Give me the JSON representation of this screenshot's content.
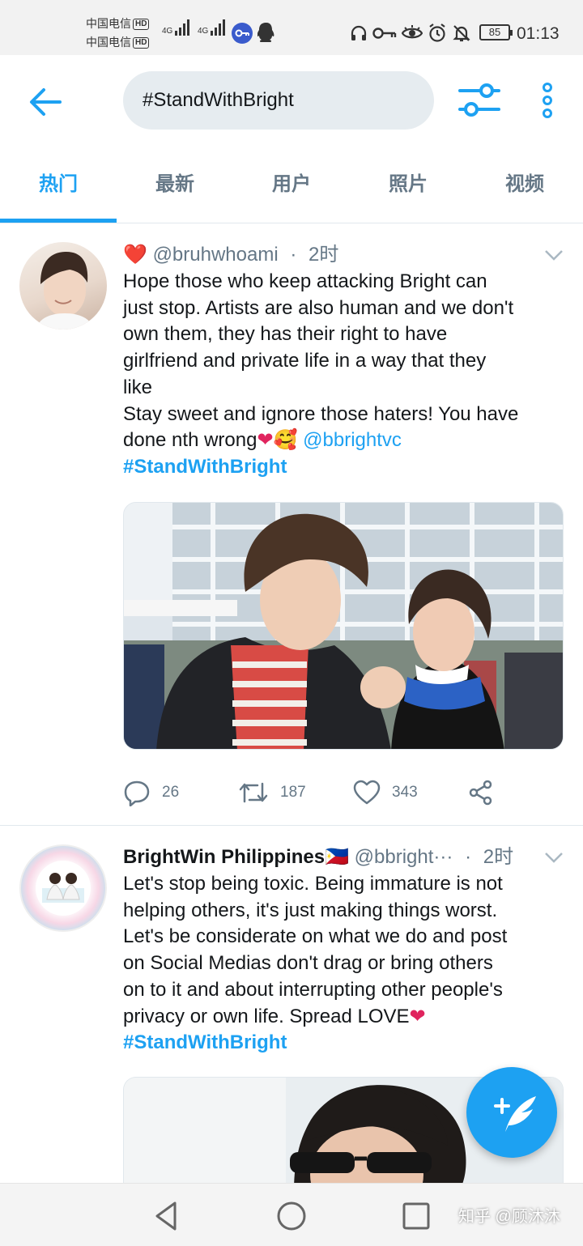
{
  "status_bar": {
    "carrier_1": "中国电信",
    "carrier_2": "中国电信",
    "hd_label": "HD",
    "network_1": "4G",
    "network_2": "4G",
    "battery": "85",
    "time": "01:13",
    "icons": [
      "vpn-key-icon",
      "qq-icon",
      "headphones-icon",
      "key-icon",
      "eye-icon",
      "alarm-icon",
      "mute-icon"
    ]
  },
  "header": {
    "search_text": "#StandWithBright",
    "back_icon": "arrow-left-icon",
    "filter_icon": "sliders-icon",
    "more_icon": "more-vertical-icon"
  },
  "tabs": [
    {
      "label": "热门",
      "active": true
    },
    {
      "label": "最新",
      "active": false
    },
    {
      "label": "用户",
      "active": false
    },
    {
      "label": "照片",
      "active": false
    },
    {
      "label": "视频",
      "active": false
    }
  ],
  "tweets": [
    {
      "name": "❤️",
      "handle": "@bruhwhoami",
      "dot": "·",
      "time": "2时",
      "lines": [
        "Hope those who keep attacking Bright can",
        "just stop. Artists are also human and we don't",
        "own them, they has their right to have",
        "girlfriend and private life in a way that they",
        "like",
        "Stay sweet and ignore those haters! You have"
      ],
      "last_line_text": "done nth wrong",
      "last_line_emoji": "❤🥰",
      "mention": "@bbrightvc",
      "hashtag": "#StandWithBright",
      "replies": "26",
      "retweets": "187",
      "likes": "343"
    },
    {
      "name": "BrightWin Philippines🇵🇭",
      "handle": "@bbright···",
      "dot": "·",
      "time": "2时",
      "lines": [
        "Let's stop being toxic. Being immature is not",
        "helping others, it's just making things worst.",
        "Let's be considerate on what we do and post",
        "on Social Medias don't drag or bring others",
        "on to it and about interrupting other people's"
      ],
      "last_line_text": "privacy or own life. Spread LOVE",
      "last_line_emoji": "❤",
      "hashtag": "#StandWithBright"
    }
  ],
  "fab": {
    "icon": "compose-tweet-icon"
  },
  "nav_bar": {
    "watermark": "知乎 @顾沐沐"
  },
  "colors": {
    "accent": "#1da1f2",
    "secondary_text": "#657786",
    "heart": "#e0245e"
  }
}
